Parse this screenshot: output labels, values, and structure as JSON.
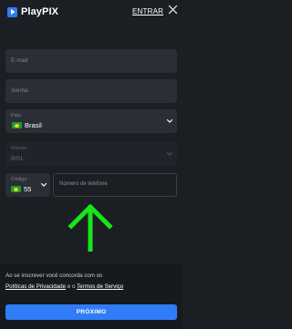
{
  "brand": {
    "name": "PlayPIX",
    "color": "#2f7cf6"
  },
  "header": {
    "login_link": "ENTRAR",
    "close_icon": "close-icon"
  },
  "form": {
    "email_placeholder": "E-mail",
    "password_placeholder": "Senha",
    "country": {
      "label": "País",
      "value": "Brasil"
    },
    "currency": {
      "label": "Moeda",
      "value": "BRL"
    },
    "phone_code": {
      "label": "Código",
      "value": "55"
    },
    "phone_placeholder": "Número de telefone"
  },
  "annotation": {
    "arrow_color": "#19e619",
    "icon": "up-arrow-icon"
  },
  "footer": {
    "terms_prefix": "Ao se inscrever você concorda com os",
    "privacy_link": "Políticas de Privacidade",
    "conjunction": "e o",
    "terms_link": "Termos de Serviço",
    "submit_label": "PRÓXIMO"
  }
}
